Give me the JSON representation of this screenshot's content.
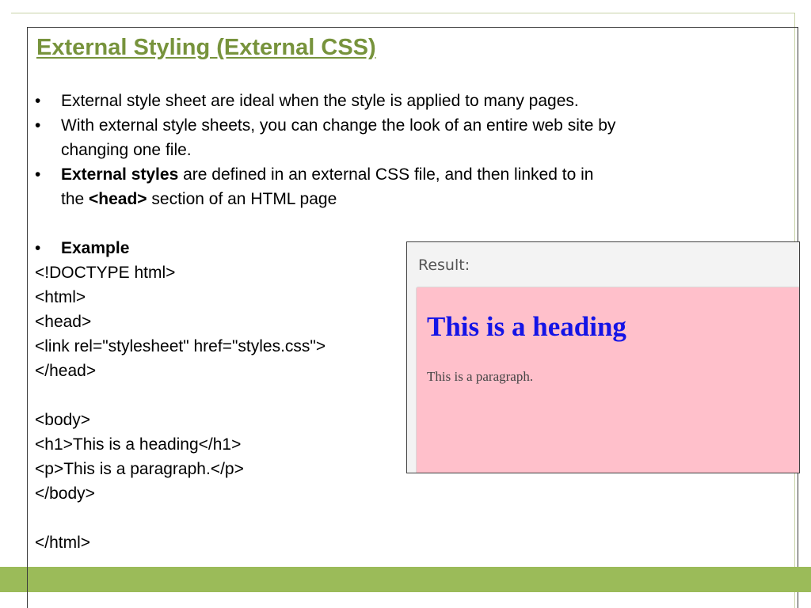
{
  "slide": {
    "title": "External Styling (External CSS)",
    "bullet_char": "•",
    "bullets": [
      {
        "text": "External style sheet are ideal when the style is applied to many pages."
      },
      {
        "line1": "With external style sheets, you can change the look of an entire web site by",
        "line2": "changing one file."
      },
      {
        "bold": "External styles",
        "text": " are defined in an external CSS file, and then linked to in",
        "line2_prefix": "the ",
        "line2_bold": "<head>",
        "line2_suffix": " section of an HTML page"
      }
    ],
    "example_label": "Example",
    "code_lines": [
      "<!DOCTYPE html>",
      "<html>",
      "<head>",
      "<link rel=\"stylesheet\" href=\"styles.css\">",
      "</head>",
      "",
      "<body>",
      "<h1>This is a heading</h1>",
      "<p>This is a paragraph.</p>",
      "</body>",
      "",
      "</html>"
    ]
  },
  "result": {
    "label": "Result:",
    "heading": "This is a heading",
    "paragraph": "This is a paragraph.",
    "background_color": "#ffc0cb",
    "heading_color": "#1414e6"
  },
  "theme": {
    "title_color": "#77933c",
    "footer_color": "#9bbb59"
  }
}
